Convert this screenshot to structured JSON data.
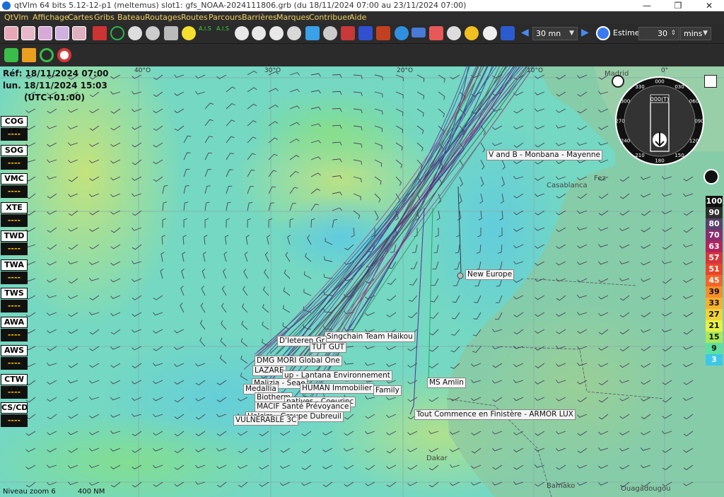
{
  "window": {
    "title": "qtVlm 64 bits 5.12-12-p1 (meltemus) slot1: gfs_NOAA-2024111806.grb (du 18/11/2024 07:00 au 23/11/2024 07:00)",
    "minimize": "—",
    "maximize": "❐",
    "close": "✕"
  },
  "menu": [
    "QtVlm",
    "Affichage",
    "Cartes",
    "Gribs",
    "Bateau",
    "Routages",
    "Routes",
    "Parcours",
    "Barrières",
    "Marques",
    "Contribuer",
    "Aide"
  ],
  "toolbar": {
    "step_value": "30 mn",
    "estime_label": "Estime",
    "estime_value": "30",
    "estime_unit": "mins"
  },
  "info": {
    "ref_line": "Réf: 18/11/2024 07:00",
    "date_line": "lun. 18/11/2024 15:03",
    "tz_line": "(UTC+01:00)"
  },
  "instruments": [
    {
      "label": "COG (T)",
      "value": "----"
    },
    {
      "label": "SOG",
      "value": "----"
    },
    {
      "label": "VMC",
      "value": "----"
    },
    {
      "label": "XTE",
      "value": "----"
    },
    {
      "label": "TWD",
      "value": "----"
    },
    {
      "label": "TWA",
      "value": "----"
    },
    {
      "label": "TWS",
      "value": "----"
    },
    {
      "label": "AWA",
      "value": "----"
    },
    {
      "label": "AWS",
      "value": "----"
    },
    {
      "label": "CTW (T)",
      "value": "----"
    },
    {
      "label": "CS/CD",
      "value": "----"
    }
  ],
  "longitudes": [
    "40°O",
    "30°O",
    "20°O",
    "10°O",
    "0°"
  ],
  "places": [
    "Madrid",
    "Fez",
    "Casablanca",
    "Dakar",
    "Bamako",
    "Ouagadougou"
  ],
  "boats": [
    "V and B - Monbana - Mayenne",
    "New Europe",
    "Singchain Team Haikou",
    "D'Ieteren Gr",
    "TUT GUT",
    "DMG MORI Global One",
    "LAZARE",
    "up - Lantana Environnement",
    "Malizia - Seae",
    "HUMAN Immobilier",
    "Family",
    "Medallia",
    "Biotherm",
    "natives - Coeurinc",
    "MACIF Santé Prévoyance",
    "Holcim - Groupe Dubreuil",
    "VULNERABLE 3C",
    "MS Amlin",
    "Tout Commence en Finistère - ARMOR LUX"
  ],
  "compass": {
    "heading": "000(T)",
    "ticks": [
      "330",
      "000",
      "030",
      "300",
      "060",
      "270",
      "090",
      "240",
      "120",
      "210",
      "180",
      "150"
    ]
  },
  "legend": [
    {
      "value": "100",
      "color": "#111111",
      "text": "#ffffff"
    },
    {
      "value": "90",
      "color": "#2f2f2f",
      "text": "#ffffff"
    },
    {
      "value": "80",
      "color": "#5a3f6b",
      "text": "#ffffff"
    },
    {
      "value": "70",
      "color": "#8a2c6e",
      "text": "#ffffff"
    },
    {
      "value": "63",
      "color": "#b5245a",
      "text": "#ffffff"
    },
    {
      "value": "57",
      "color": "#d8343c",
      "text": "#ffffff"
    },
    {
      "value": "51",
      "color": "#e9452b",
      "text": "#ffffff"
    },
    {
      "value": "45",
      "color": "#f2652a",
      "text": "#ffffff"
    },
    {
      "value": "39",
      "color": "#f58e2a",
      "text": "#111111"
    },
    {
      "value": "33",
      "color": "#f5b02c",
      "text": "#111111"
    },
    {
      "value": "27",
      "color": "#f0d23a",
      "text": "#111111"
    },
    {
      "value": "21",
      "color": "#e8f046",
      "text": "#111111"
    },
    {
      "value": "15",
      "color": "#a8e85a",
      "text": "#111111"
    },
    {
      "value": "9",
      "color": "#5ee0a0",
      "text": "#111111"
    },
    {
      "value": "3",
      "color": "#3cc8e8",
      "text": "#ffffff"
    }
  ],
  "status": {
    "zoom": "Niveau zoom 6",
    "scale": "400 NM"
  }
}
